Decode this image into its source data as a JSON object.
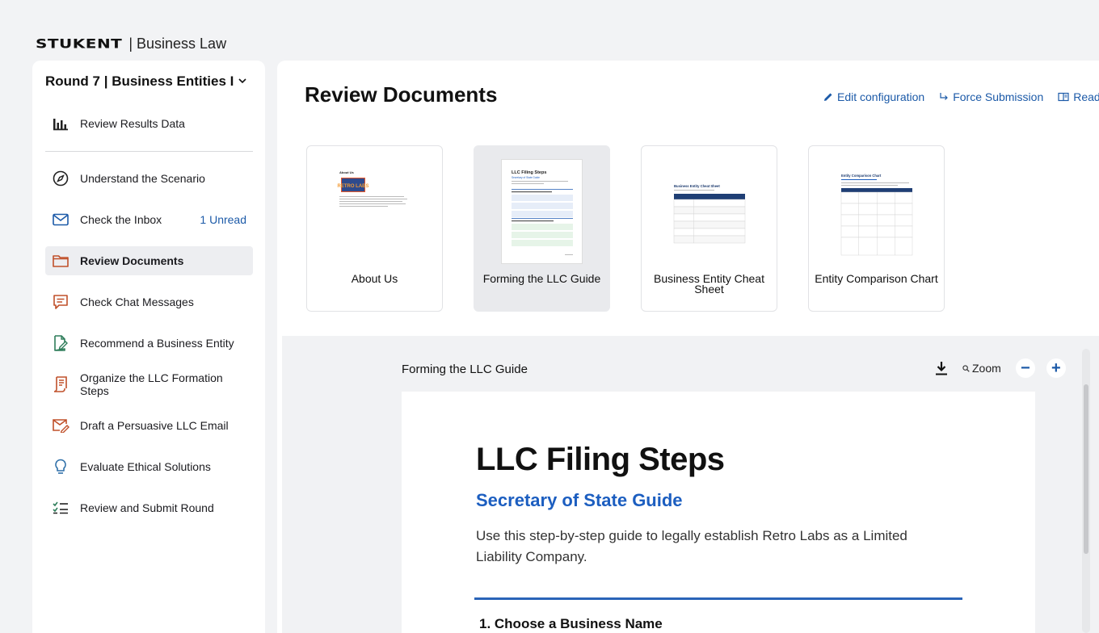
{
  "brand": {
    "logo": "STUKENT",
    "product": "| Business Law"
  },
  "sidebar": {
    "round_title": "Round 7 | Business Entities I",
    "items": [
      {
        "label": "Review Results Data",
        "icon": "bar-chart-icon"
      },
      {
        "label": "Understand the Scenario",
        "icon": "compass-icon"
      },
      {
        "label": "Check the Inbox",
        "icon": "envelope-icon",
        "badge": "1 Unread"
      },
      {
        "label": "Review Documents",
        "icon": "folder-icon",
        "active": true
      },
      {
        "label": "Check Chat Messages",
        "icon": "chat-icon"
      },
      {
        "label": "Recommend a Business Entity",
        "icon": "document-edit-icon"
      },
      {
        "label": "Organize the LLC Formation Steps",
        "icon": "scroll-icon"
      },
      {
        "label": "Draft a Persuasive LLC Email",
        "icon": "envelope-pen-icon"
      },
      {
        "label": "Evaluate Ethical Solutions",
        "icon": "lightbulb-icon"
      },
      {
        "label": "Review and Submit Round",
        "icon": "checklist-icon"
      }
    ]
  },
  "main": {
    "title": "Review Documents",
    "toolbar": {
      "edit": "Edit configuration",
      "force": "Force Submission",
      "reading": "Readin"
    },
    "cards": [
      {
        "label": "About Us"
      },
      {
        "label": "Forming the LLC Guide",
        "selected": true
      },
      {
        "label": "Business Entity Cheat Sheet"
      },
      {
        "label": "Entity Comparison Chart"
      }
    ],
    "thumbs": {
      "about_title": "About Us",
      "about_logo": "RETRO LABS",
      "llc_title": "LLC Filing Steps",
      "llc_subtitle": "Secretary of State Guide",
      "cheat_title": "Business Entity Cheat Sheet",
      "compare_title": "Entity Comparison Chart"
    },
    "viewer": {
      "title": "Forming the LLC Guide",
      "zoom_label": "Zoom",
      "minus": "−",
      "plus": "+",
      "doc": {
        "h1": "LLC Filing Steps",
        "h2": "Secretary of State Guide",
        "intro": "Use this step-by-step guide to legally establish Retro Labs as a Limited Liability Company.",
        "step1": "1. Choose a Business Name"
      }
    }
  },
  "colors": {
    "accent": "#1c5aa8",
    "doc_blue": "#1c5ec0",
    "active_bg": "#edeef1",
    "icon_orange": "#c0502a"
  }
}
